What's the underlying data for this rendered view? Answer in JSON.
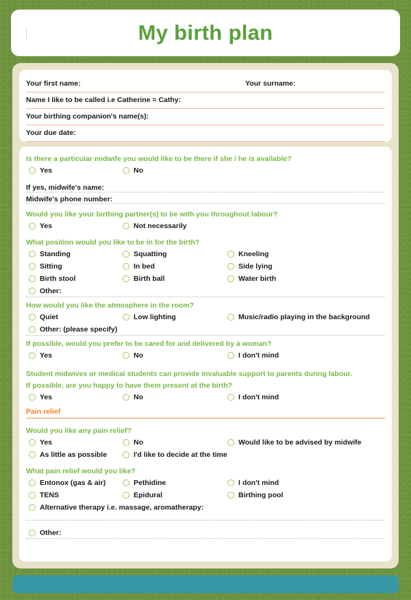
{
  "header": {
    "title": "My birth plan"
  },
  "identity": {
    "rows": [
      {
        "label": "Your first name:",
        "label_right": "Your surname:"
      },
      {
        "label": "Name I like to be called i.e Catherine = Cathy:"
      },
      {
        "label": "Your birthing companion's name(s):"
      },
      {
        "label": "Your due date:"
      }
    ]
  },
  "questions": {
    "midwife": {
      "title": "Is there a particular midwife you would like to be there if she / he is available?",
      "options": [
        "Yes",
        "No"
      ],
      "followups": [
        "If yes, midwife's name:",
        "Midwife's phone number:"
      ]
    },
    "partner": {
      "title": "Would you like your birthing partner(s) to be with you throughout labour?",
      "options": [
        "Yes",
        "Not necessarily"
      ]
    },
    "position": {
      "title": "What position would you like to be in for the birth?",
      "options": [
        "Standing",
        "Squatting",
        "Kneeling",
        "Sitting",
        "In bed",
        "Side lying",
        "Birth stool",
        "Birth ball",
        "Water birth"
      ],
      "other": "Other:"
    },
    "atmosphere": {
      "title": "How would you like the atmosphere in the room?",
      "options": [
        "Quiet",
        "Low lighting",
        "Music/radio playing in the background"
      ],
      "other": "Other: (please specify)"
    },
    "woman_carer": {
      "title": "If possible, would you prefer to be cared for and delivered by a woman?",
      "options": [
        "Yes",
        "No",
        "I don't mind"
      ]
    },
    "students": {
      "title_line1": "Student midwives or medical students can provide invaluable support to parents during labour.",
      "title_line2": "If possible, are you happy to have them present at the birth?",
      "options": [
        "Yes",
        "No",
        "I don't mind"
      ]
    }
  },
  "pain_relief": {
    "section_title": "Pain relief",
    "want": {
      "title": "Would you like any pain relief?",
      "options": [
        "Yes",
        "No",
        "Would like to be advised by midwife",
        "As little as possible",
        "I'd like to decide at the time"
      ]
    },
    "which": {
      "title": "What pain relief would you like?",
      "options": [
        "Entonox (gas & air)",
        "Pethidine",
        "I don't mind",
        "TENS",
        "Epidural",
        "Birthing pool"
      ],
      "alternative": "Alternative therapy i.e. massage, aromatherapy:",
      "other": "Other:"
    }
  },
  "colors": {
    "background_green": "#6f9440",
    "title_green": "#5aa03c",
    "question_green": "#7ab648",
    "radio_green": "#a9c54c",
    "accent_orange": "#f58024",
    "line_peach": "#f4b79a",
    "panel_beige": "#e9e2ca",
    "footer_teal": "#3798a5"
  }
}
